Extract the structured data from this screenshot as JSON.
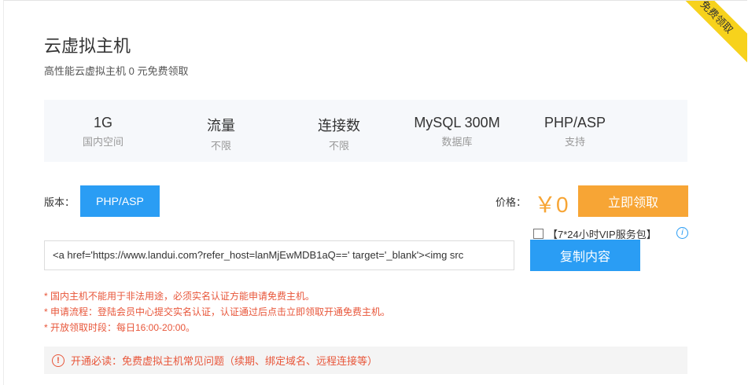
{
  "header": {
    "title": "云虚拟主机",
    "subtitle": "高性能云虚拟主机 0 元免费领取",
    "corner_badge": "免费领取"
  },
  "specs": [
    {
      "main": "1G",
      "sub": "国内空间"
    },
    {
      "main": "流量",
      "sub": "不限"
    },
    {
      "main": "连接数",
      "sub": "不限"
    },
    {
      "main": "MySQL 300M",
      "sub": "数据库"
    },
    {
      "main": "PHP/ASP",
      "sub": "支持"
    }
  ],
  "version": {
    "label": "版本：",
    "selected": "PHP/ASP"
  },
  "price": {
    "label": "价格：",
    "value": "￥0",
    "claim_label": "立即领取"
  },
  "vip": {
    "label": "【7*24小时VIP服务包】",
    "checked": false
  },
  "code": {
    "value": "<a href='https://www.landui.com?refer_host=lanMjEwMDB1aQ==' target='_blank'><img src",
    "copy_label": "复制内容"
  },
  "notes": [
    "* 国内主机不能用于非法用途，必须实名认证方能申请免费主机。",
    "* 申请流程：登陆会员中心提交实名认证，认证通过后点击立即领取开通免费主机。",
    "* 开放领取时段：每日16:00-20:00。"
  ],
  "notice": {
    "text": "开通必读：免费虚拟主机常见问题（续期、绑定域名、远程连接等）"
  },
  "colors": {
    "primary": "#2a9df4",
    "accent": "#f7a535",
    "warning": "#e8563a",
    "badge": "#f7d21c"
  }
}
